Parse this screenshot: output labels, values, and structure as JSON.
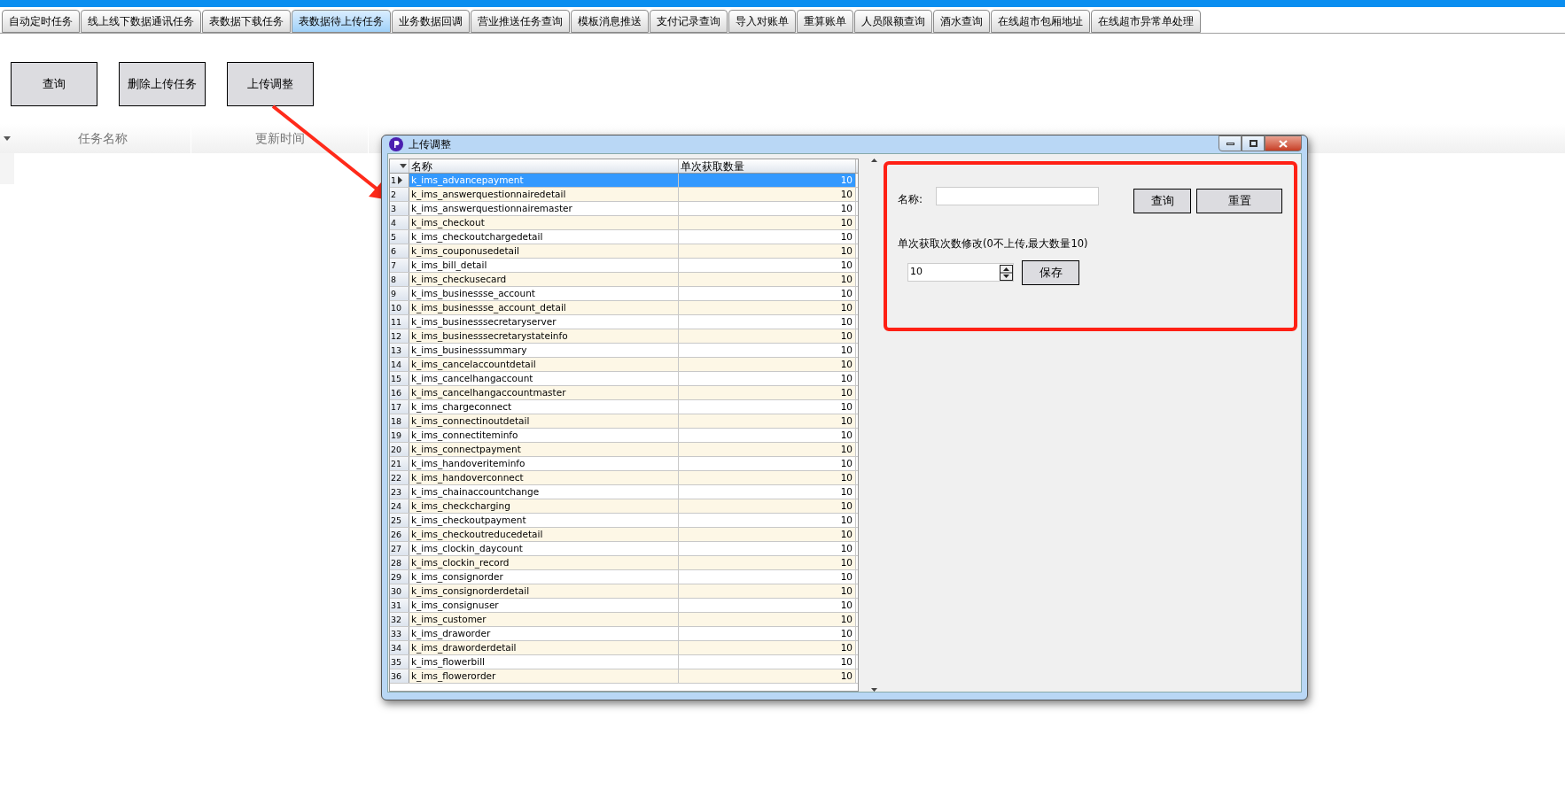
{
  "tabs": [
    {
      "label": "自动定时任务",
      "selected": false
    },
    {
      "label": "线上线下数据通讯任务",
      "selected": false
    },
    {
      "label": "表数据下载任务",
      "selected": false
    },
    {
      "label": "表数据待上传任务",
      "selected": true
    },
    {
      "label": "业务数据回调",
      "selected": false
    },
    {
      "label": "营业推送任务查询",
      "selected": false
    },
    {
      "label": "模板消息推送",
      "selected": false
    },
    {
      "label": "支付记录查询",
      "selected": false
    },
    {
      "label": "导入对账单",
      "selected": false
    },
    {
      "label": "重算账单",
      "selected": false
    },
    {
      "label": "人员限额查询",
      "selected": false
    },
    {
      "label": "酒水查询",
      "selected": false
    },
    {
      "label": "在线超市包厢地址",
      "selected": false
    },
    {
      "label": "在线超市异常单处理",
      "selected": false
    }
  ],
  "toolbar": [
    "查询",
    "删除上传任务",
    "上传调整"
  ],
  "table": {
    "columns": [
      "任务名称",
      "更新时间"
    ]
  },
  "dialog": {
    "title": "上传调整",
    "grid": {
      "columns": [
        "名称",
        "单次获取数量"
      ],
      "rows": [
        {
          "num": "1",
          "name": "k_ims_advancepayment",
          "qty": "10",
          "selected": true
        },
        {
          "num": "2",
          "name": "k_ims_answerquestionnairedetail",
          "qty": "10",
          "selected": false
        },
        {
          "num": "3",
          "name": "k_ims_answerquestionnairemaster",
          "qty": "10",
          "selected": false
        },
        {
          "num": "4",
          "name": "k_ims_checkout",
          "qty": "10",
          "selected": false
        },
        {
          "num": "5",
          "name": "k_ims_checkoutchargedetail",
          "qty": "10",
          "selected": false
        },
        {
          "num": "6",
          "name": "k_ims_couponusedetail",
          "qty": "10",
          "selected": false
        },
        {
          "num": "7",
          "name": "k_ims_bill_detail",
          "qty": "10",
          "selected": false
        },
        {
          "num": "8",
          "name": "k_ims_checkusecard",
          "qty": "10",
          "selected": false
        },
        {
          "num": "9",
          "name": "k_ims_businessse_account",
          "qty": "10",
          "selected": false
        },
        {
          "num": "10",
          "name": "k_ims_businessse_account_detail",
          "qty": "10",
          "selected": false
        },
        {
          "num": "11",
          "name": "k_ims_businesssecretaryserver",
          "qty": "10",
          "selected": false
        },
        {
          "num": "12",
          "name": "k_ims_businesssecretarystateinfo",
          "qty": "10",
          "selected": false
        },
        {
          "num": "13",
          "name": "k_ims_businesssummary",
          "qty": "10",
          "selected": false
        },
        {
          "num": "14",
          "name": "k_ims_cancelaccountdetail",
          "qty": "10",
          "selected": false
        },
        {
          "num": "15",
          "name": "k_ims_cancelhangaccount",
          "qty": "10",
          "selected": false
        },
        {
          "num": "16",
          "name": "k_ims_cancelhangaccountmaster",
          "qty": "10",
          "selected": false
        },
        {
          "num": "17",
          "name": "k_ims_chargeconnect",
          "qty": "10",
          "selected": false
        },
        {
          "num": "18",
          "name": "k_ims_connectinoutdetail",
          "qty": "10",
          "selected": false
        },
        {
          "num": "19",
          "name": "k_ims_connectiteminfo",
          "qty": "10",
          "selected": false
        },
        {
          "num": "20",
          "name": "k_ims_connectpayment",
          "qty": "10",
          "selected": false
        },
        {
          "num": "21",
          "name": "k_ims_handoveriteminfo",
          "qty": "10",
          "selected": false
        },
        {
          "num": "22",
          "name": "k_ims_handoverconnect",
          "qty": "10",
          "selected": false
        },
        {
          "num": "23",
          "name": "k_ims_chainaccountchange",
          "qty": "10",
          "selected": false
        },
        {
          "num": "24",
          "name": "k_ims_checkcharging",
          "qty": "10",
          "selected": false
        },
        {
          "num": "25",
          "name": "k_ims_checkoutpayment",
          "qty": "10",
          "selected": false
        },
        {
          "num": "26",
          "name": "k_ims_checkoutreducedetail",
          "qty": "10",
          "selected": false
        },
        {
          "num": "27",
          "name": "k_ims_clockin_daycount",
          "qty": "10",
          "selected": false
        },
        {
          "num": "28",
          "name": "k_ims_clockin_record",
          "qty": "10",
          "selected": false
        },
        {
          "num": "29",
          "name": "k_ims_consignorder",
          "qty": "10",
          "selected": false
        },
        {
          "num": "30",
          "name": "k_ims_consignorderdetail",
          "qty": "10",
          "selected": false
        },
        {
          "num": "31",
          "name": "k_ims_consignuser",
          "qty": "10",
          "selected": false
        },
        {
          "num": "32",
          "name": "k_ims_customer",
          "qty": "10",
          "selected": false
        },
        {
          "num": "33",
          "name": "k_ims_draworder",
          "qty": "10",
          "selected": false
        },
        {
          "num": "34",
          "name": "k_ims_draworderdetail",
          "qty": "10",
          "selected": false
        },
        {
          "num": "35",
          "name": "k_ims_flowerbill",
          "qty": "10",
          "selected": false
        },
        {
          "num": "36",
          "name": "k_ims_flowerorder",
          "qty": "10",
          "selected": false
        }
      ]
    },
    "panel": {
      "name_label": "名称:",
      "query_button": "查询",
      "reset_button": "重置",
      "hint": "单次获取次数修改(0不上传,最大数量10)",
      "count_value": "10",
      "save_button": "保存"
    }
  }
}
